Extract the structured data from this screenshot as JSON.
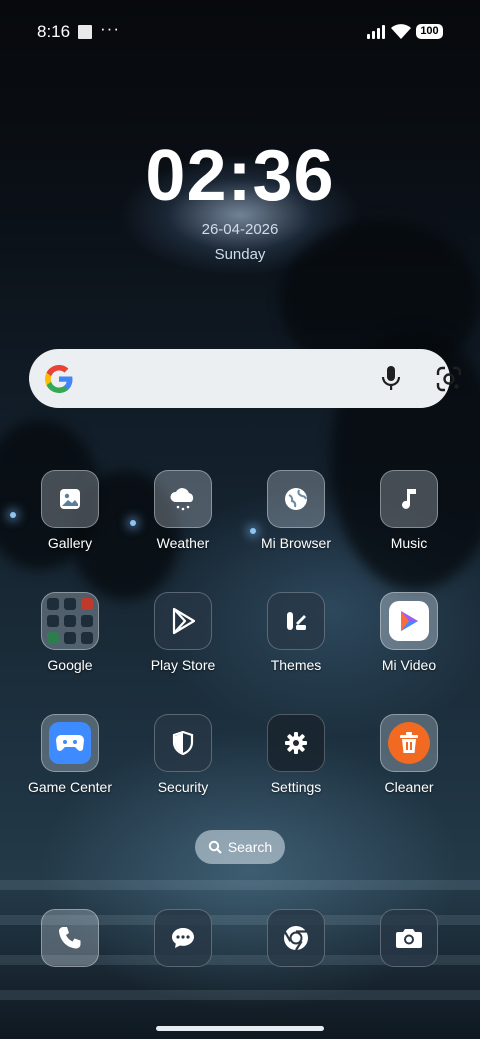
{
  "status_bar": {
    "time": "8:16",
    "overflow": "···",
    "battery": "100",
    "icons": [
      "notification-square-icon",
      "signal-icon",
      "wifi-icon",
      "battery-icon"
    ]
  },
  "clock": {
    "time": "02:36",
    "date": "26-04-2026",
    "day": "Sunday"
  },
  "search_widget": {
    "icons": [
      "google-logo-icon",
      "microphone-icon",
      "google-lens-icon"
    ]
  },
  "apps": [
    {
      "label": "Gallery",
      "icon": "gallery-icon"
    },
    {
      "label": "Weather",
      "icon": "weather-icon"
    },
    {
      "label": "Mi Browser",
      "icon": "globe-icon"
    },
    {
      "label": "Music",
      "icon": "music-note-icon"
    },
    {
      "label": "Google",
      "icon": "folder-icon"
    },
    {
      "label": "Play Store",
      "icon": "play-store-icon"
    },
    {
      "label": "Themes",
      "icon": "themes-icon"
    },
    {
      "label": "Mi Video",
      "icon": "video-play-icon"
    },
    {
      "label": "Game Center",
      "icon": "gamepad-icon"
    },
    {
      "label": "Security",
      "icon": "shield-icon"
    },
    {
      "label": "Settings",
      "icon": "gear-icon"
    },
    {
      "label": "Cleaner",
      "icon": "trash-icon"
    }
  ],
  "app_search": {
    "label": "Search"
  },
  "dock": [
    {
      "icon": "phone-icon"
    },
    {
      "icon": "messages-icon"
    },
    {
      "icon": "chrome-icon"
    },
    {
      "icon": "camera-icon"
    }
  ],
  "colors": {
    "accent_blue": "#3d8bff",
    "cleaner_orange": "#f26a21",
    "search_bar": "#eceff1"
  }
}
